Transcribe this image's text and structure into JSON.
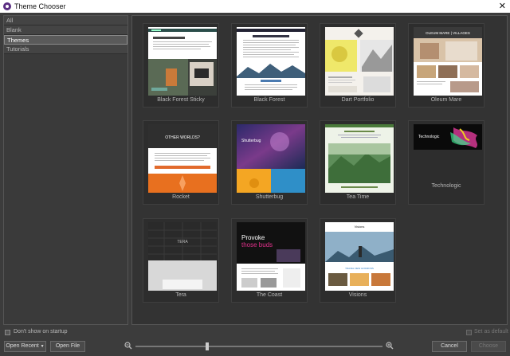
{
  "window": {
    "title": "Theme Chooser",
    "close_glyph": "✕"
  },
  "sidebar": {
    "items": [
      {
        "label": "All"
      },
      {
        "label": "Blank"
      },
      {
        "label": "Themes"
      },
      {
        "label": "Tutorials"
      }
    ]
  },
  "themes": [
    {
      "name": "Black Forest Sticky"
    },
    {
      "name": "Black Forest"
    },
    {
      "name": "Dart Portfolio"
    },
    {
      "name": "Oleum Mare"
    },
    {
      "name": "Rocket"
    },
    {
      "name": "Shutterbug"
    },
    {
      "name": "Tea Time"
    },
    {
      "name": "Technologic"
    },
    {
      "name": "Tera"
    },
    {
      "name": "The Coast"
    },
    {
      "name": "Visions"
    }
  ],
  "thumb_text": {
    "oleum": "OLEUM MARE | VILLAGES",
    "rocket": "OTHER WORLDS?",
    "tera": "TERA",
    "coast_1": "Provoke",
    "coast_2": "those buds",
    "visions": "Visions",
    "visions_sub": "TRAVEL NEW HORIZONS",
    "technologic": "Technologic",
    "shutterbug": "Shutterbug"
  },
  "footer": {
    "dont_show_label": "Don't show on startup",
    "set_default_label": "Set as default",
    "open_recent_label": "Open Recent",
    "open_file_label": "Open File",
    "cancel_label": "Cancel",
    "choose_label": "Choose",
    "zoom_level": 0.29
  },
  "colors": {
    "accent": "#5a2d82",
    "bg": "#3c3c3c"
  }
}
